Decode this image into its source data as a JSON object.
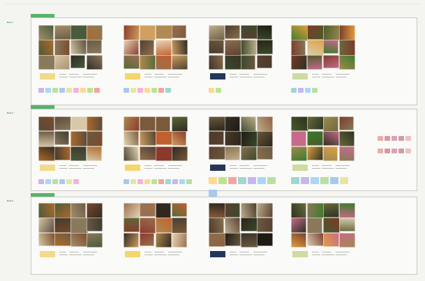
{
  "colors": {
    "section_tag": "#57b26a",
    "section_border": "#c9c9c4",
    "label_gold": "#f2da8a",
    "label_navy": "#24375a",
    "label_olive": "#cfdba0",
    "chip_palette": [
      "#c9b5f0",
      "#a8d8f5",
      "#b8e0a0",
      "#a6c9f0",
      "#e6e6a0",
      "#f2b4d8",
      "#ffd890",
      "#b9e68a",
      "#f5a3a3",
      "#9ed8d0"
    ]
  },
  "rows": [
    {
      "row_label": "Row 1",
      "row_sublabel": "",
      "tag": "",
      "board_title": "",
      "note": ""
    },
    {
      "row_label": "Row 2",
      "row_sublabel": "",
      "tag": "",
      "board_title": "",
      "note": ""
    },
    {
      "row_label": "Row 3",
      "row_sublabel": "",
      "tag": "",
      "board_title": "",
      "note": ""
    }
  ],
  "icons": {
    "photo": "photo-tile-icon"
  }
}
